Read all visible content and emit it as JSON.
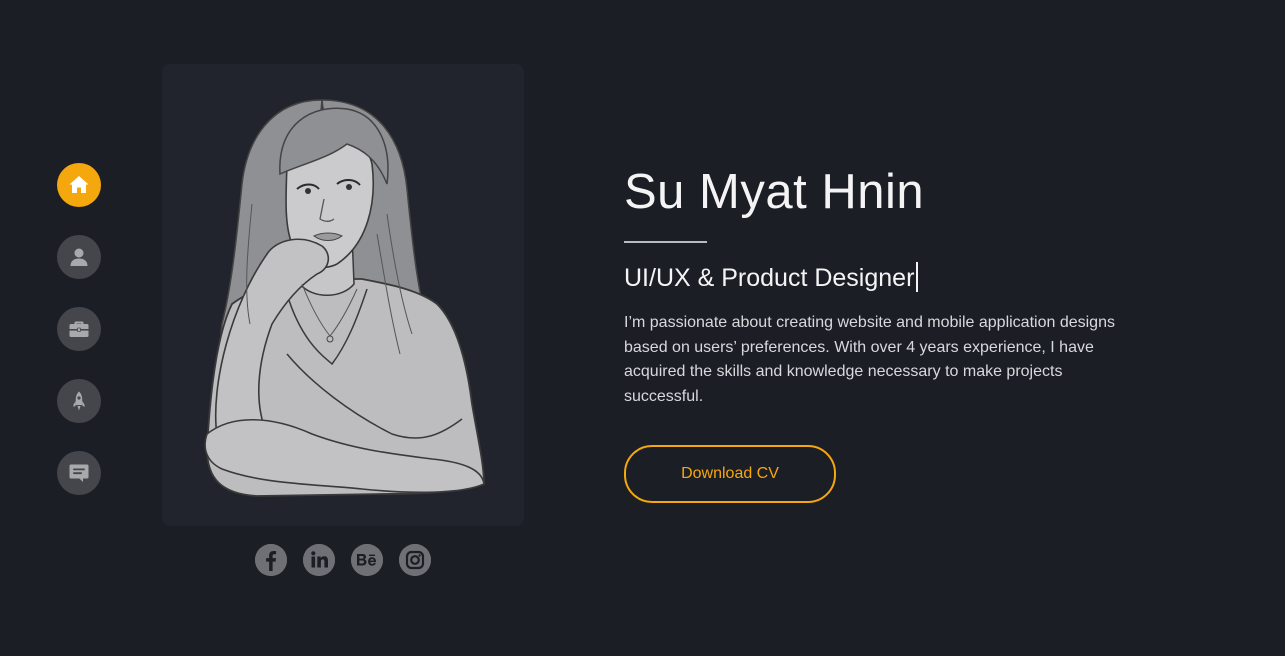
{
  "nav": {
    "items": [
      {
        "icon": "home-icon",
        "active": true
      },
      {
        "icon": "user-icon",
        "active": false
      },
      {
        "icon": "briefcase-icon",
        "active": false
      },
      {
        "icon": "rocket-icon",
        "active": false
      },
      {
        "icon": "message-icon",
        "active": false
      }
    ]
  },
  "hero": {
    "name": "Su Myat Hnin",
    "role": "UI/UX & Product Designer",
    "bio": "I’m passionate about creating website and mobile application designs based on users’ preferences. With over 4 years experience, I have acquired the skills and knowledge necessary to make projects successful.",
    "cta_label": "Download CV"
  },
  "social": [
    {
      "icon": "facebook-icon"
    },
    {
      "icon": "linkedin-icon"
    },
    {
      "icon": "behance-icon"
    },
    {
      "icon": "instagram-icon"
    }
  ],
  "colors": {
    "background": "#1c1e26",
    "card": "#22242d",
    "accent": "#f5a70e",
    "nav_inactive": "#44464c",
    "text": "#f4f4f5"
  }
}
